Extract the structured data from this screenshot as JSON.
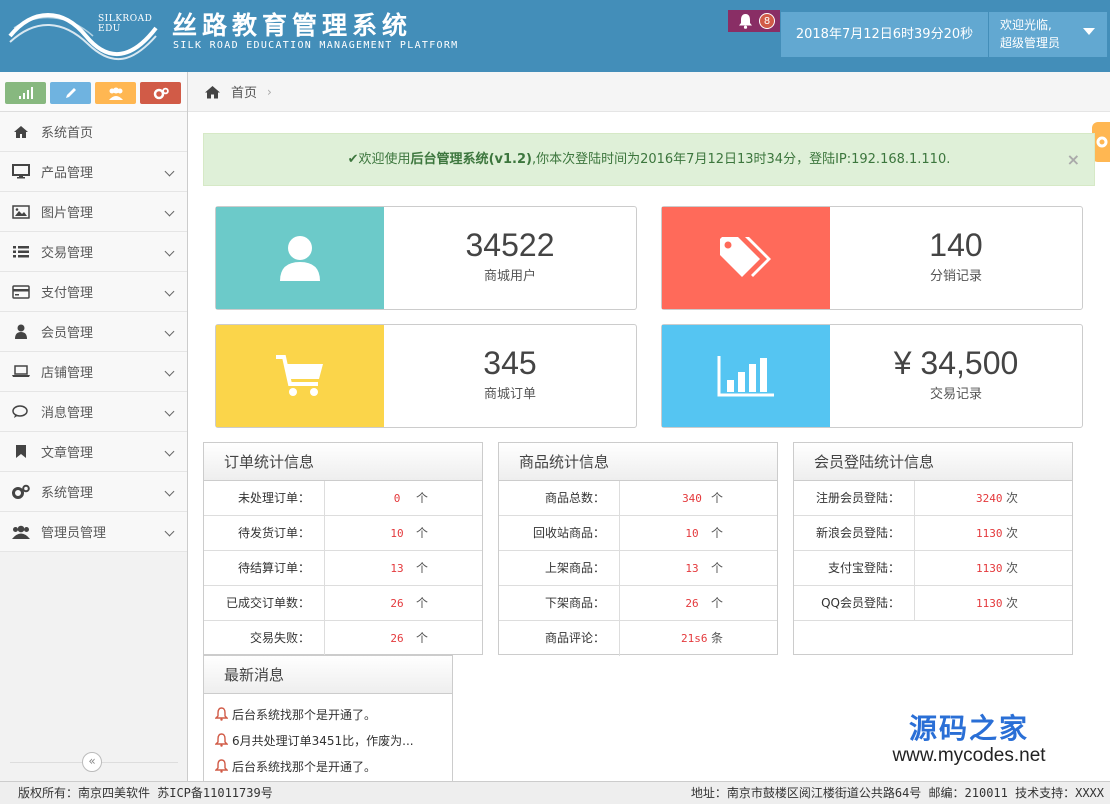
{
  "header": {
    "logo_text": "SILKROAD EDU",
    "title_cn": "丝路教育管理系统",
    "title_en": "SILK ROAD EDUCATION MANAGEMENT PLATFORM",
    "notification_count": "8",
    "datetime": "2018年7月12日6时39分20秒",
    "welcome": "欢迎光临,",
    "user_role": "超级管理员"
  },
  "colors": {
    "header_bg": "#438eb9",
    "shortcut_green": "#87b87f",
    "shortcut_blue": "#6fb3e0",
    "shortcut_orange": "#ffb752",
    "shortcut_red": "#d15b47",
    "stat_teal": "#6ccac9",
    "stat_red": "#ff6a5a",
    "stat_yellow": "#fbd54a",
    "stat_blue": "#55c5f2"
  },
  "sidebar": {
    "shortcuts": [
      "signal-icon",
      "pencil-icon",
      "users-icon",
      "cogs-icon"
    ],
    "items": [
      {
        "label": "系统首页",
        "icon": "home-icon"
      },
      {
        "label": "产品管理",
        "icon": "desktop-icon"
      },
      {
        "label": "图片管理",
        "icon": "picture-icon"
      },
      {
        "label": "交易管理",
        "icon": "list-icon"
      },
      {
        "label": "支付管理",
        "icon": "credit-card-icon"
      },
      {
        "label": "会员管理",
        "icon": "user-icon"
      },
      {
        "label": "店铺管理",
        "icon": "laptop-icon"
      },
      {
        "label": "消息管理",
        "icon": "comments-icon"
      },
      {
        "label": "文章管理",
        "icon": "bookmark-icon"
      },
      {
        "label": "系统管理",
        "icon": "cogs-icon"
      },
      {
        "label": "管理员管理",
        "icon": "group-icon"
      }
    ],
    "collapse_glyph": "«"
  },
  "breadcrumb": {
    "home": "首页",
    "sep": "›"
  },
  "alert": {
    "check": "✔",
    "prefix": "欢迎使用",
    "system": "后台管理系统",
    "version": "(v1.2)",
    "suffix": ",你本次登陆时间为2016年7月12日13时34分，登陆IP:192.168.1.110.",
    "close": "×"
  },
  "stats": [
    {
      "value": "34522",
      "label": "商城用户",
      "icon": "user-icon"
    },
    {
      "value": "140",
      "label": "分销记录",
      "icon": "tags-icon"
    },
    {
      "value": "345",
      "label": "商城订单",
      "icon": "cart-icon"
    },
    {
      "value": "¥ 34,500",
      "label": "交易记录",
      "icon": "bar-chart-icon"
    }
  ],
  "order_stats": {
    "title": "订单统计信息",
    "rows": [
      {
        "k": "未处理订单：",
        "v": "0",
        "u": "个"
      },
      {
        "k": "待发货订单：",
        "v": "10",
        "u": "个"
      },
      {
        "k": "待结算订单：",
        "v": "13",
        "u": "个"
      },
      {
        "k": "已成交订单数：",
        "v": "26",
        "u": "个"
      },
      {
        "k": "交易失败：",
        "v": "26",
        "u": "个"
      }
    ]
  },
  "product_stats": {
    "title": "商品统计信息",
    "rows": [
      {
        "k": "商品总数：",
        "v": "340",
        "u": "个"
      },
      {
        "k": "回收站商品：",
        "v": "10",
        "u": "个"
      },
      {
        "k": "上架商品：",
        "v": "13",
        "u": "个"
      },
      {
        "k": "下架商品：",
        "v": "26",
        "u": "个"
      },
      {
        "k": "商品评论：",
        "v": "21s6",
        "u": "条"
      }
    ]
  },
  "member_stats": {
    "title": "会员登陆统计信息",
    "rows": [
      {
        "k": "注册会员登陆：",
        "v": "3240",
        "u": "次"
      },
      {
        "k": "新浪会员登陆：",
        "v": "1130",
        "u": "次"
      },
      {
        "k": "支付宝登陆：",
        "v": "1130",
        "u": "次"
      },
      {
        "k": "QQ会员登陆：",
        "v": "1130",
        "u": "次"
      }
    ]
  },
  "news": {
    "title": "最新消息",
    "items": [
      "后台系统找那个是开通了。",
      "6月共处理订单3451比，作废为...",
      "后台系统找那个是开通了。"
    ]
  },
  "footer": {
    "copyright": "版权所有：南京四美软件 苏ICP备11011739号",
    "address": "地址：南京市鼓楼区阅江楼街道公共路64号 邮编：210011 技术支持：XXXX"
  },
  "watermark": {
    "line1": "源码之家",
    "line2": "www.mycodes.net"
  }
}
